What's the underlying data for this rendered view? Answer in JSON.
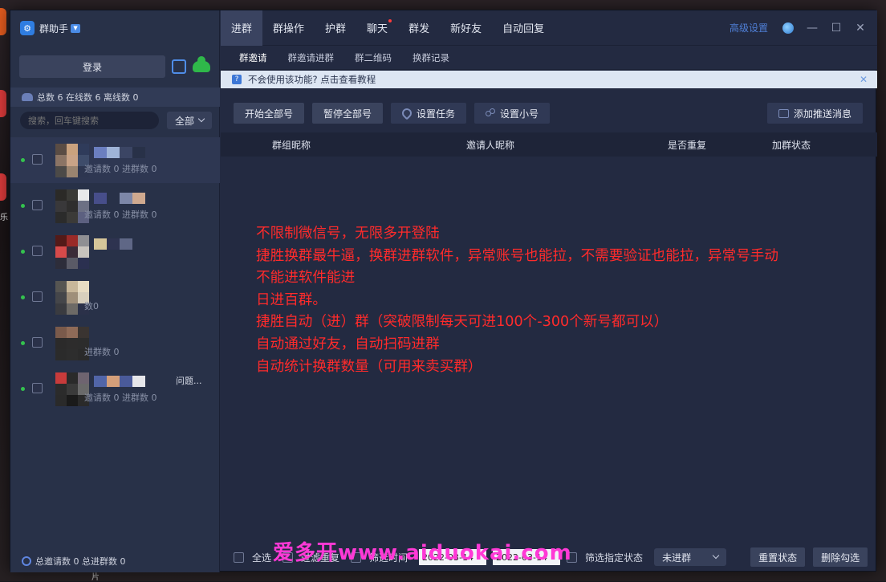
{
  "window": {
    "app_title": "群助手"
  },
  "sidebar": {
    "login_label": "登录",
    "stats": "总数 6 在线数 6 离线数 0",
    "search_placeholder": "搜索，回车键搜索",
    "filter_value": "全部",
    "accounts": [
      {
        "sub": "邀请数 0 进群数 0",
        "tag": "",
        "colors": [
          "#5a4c44",
          "#caa27e",
          "#2f3b5a",
          "#8b7465",
          "#c9a387",
          "#3e4c6a",
          "#4c4a48",
          "#9a8470",
          "#2d3650"
        ],
        "name_colors": [
          "#6b7fc0",
          "#9fb4d8",
          "#3b4564",
          "#283148"
        ]
      },
      {
        "sub": "邀请数 0 进群数 0",
        "tag": "",
        "colors": [
          "#2b2a27",
          "#3a3a36",
          "#e8e9ea",
          "#39383a",
          "#2f2e2e",
          "#6c7084",
          "#2b2b2b",
          "#3b3a38",
          "#5c6080"
        ],
        "name_colors": [
          "#474e8a",
          "#283148",
          "#7d87a8",
          "#cfa98f"
        ]
      },
      {
        "sub": "",
        "tag": "",
        "colors": [
          "#531a18",
          "#9a2a28",
          "#8f8f93",
          "#d64a4a",
          "#3b2b38",
          "#c8c3bd",
          "#2d2d3a",
          "#5a5a66",
          "#2b3050"
        ],
        "name_colors": [
          "#d6c69a",
          "#2e3350",
          "#5f6786",
          "#283148"
        ]
      },
      {
        "sub": "数0",
        "tag": "",
        "colors": [
          "#565552",
          "#c8b79a",
          "#e8dcc3",
          "#45464a",
          "#9f8f7a",
          "#d8cfbd",
          "#3a3b40",
          "#6d6a66",
          "#2b3149"
        ],
        "name_colors": [
          "#283148",
          "#283148",
          "#283148",
          "#283148"
        ]
      },
      {
        "sub": "进群数 0",
        "tag": "",
        "colors": [
          "#7a5a4b",
          "#8f6b58",
          "#3a3431",
          "#2b2a2a",
          "#2d2c2c",
          "#2c2c2c",
          "#2b2b2b",
          "#2d2d2d",
          "#2a2a2a"
        ],
        "name_colors": [
          "#283148",
          "#283148",
          "#283148",
          "#283148"
        ]
      },
      {
        "sub": "邀请数 0 进群数 0",
        "tag": "问题...",
        "colors": [
          "#c83b3b",
          "#2a2a2a",
          "#6e6470",
          "#2b2b2b",
          "#3a3a3a",
          "#6a6a6a",
          "#2a2a2a",
          "#1a1a1a",
          "#2a2a2a"
        ],
        "name_colors": [
          "#5165a8",
          "#d49f7a",
          "#4a5a9a",
          "#e6e6ea"
        ]
      }
    ],
    "bottom_stats": "总邀请数 0 总进群数 0"
  },
  "topnav": {
    "tabs": [
      "进群",
      "群操作",
      "护群",
      "聊天",
      "群发",
      "新好友",
      "自动回复"
    ],
    "advanced_settings": "高级设置"
  },
  "subtabs": [
    "群邀请",
    "群邀请进群",
    "群二维码",
    "换群记录"
  ],
  "tipbar": {
    "text": "不会使用该功能? 点击查看教程"
  },
  "toolbar": {
    "start_all": "开始全部号",
    "pause_all": "暂停全部号",
    "set_task": "设置任务",
    "set_sub": "设置小号",
    "add_push": "添加推送消息"
  },
  "table": {
    "headers": [
      "群组昵称",
      "邀请人昵称",
      "是否重复",
      "加群状态"
    ]
  },
  "overlay_lines": [
    "不限制微信号，无限多开登陆",
    "捷胜换群最牛逼，换群进群软件，异常账号也能拉，不需要验证也能拉，异常号手动",
    "不能进软件能进",
    "日进百群。",
    "捷胜自动（进）群（突破限制每天可进100个-300个新号都可以）",
    "自动通过好友，自动扫码进群",
    "自动统计换群数量（可用来卖买群）"
  ],
  "footer": {
    "select_all": "全选",
    "filter_dup": "过滤重复",
    "date_label": "筛选时间",
    "date_from": "2022-03-14",
    "date_to": "2022-03-14",
    "state_label": "筛选指定状态",
    "state_value": "未进群",
    "reset_state": "重置状态",
    "delete_selected": "删除勾选"
  },
  "watermark": "爱多开www.aiduokai.com",
  "desktop": {
    "labels": [
      "乐",
      "片"
    ]
  }
}
